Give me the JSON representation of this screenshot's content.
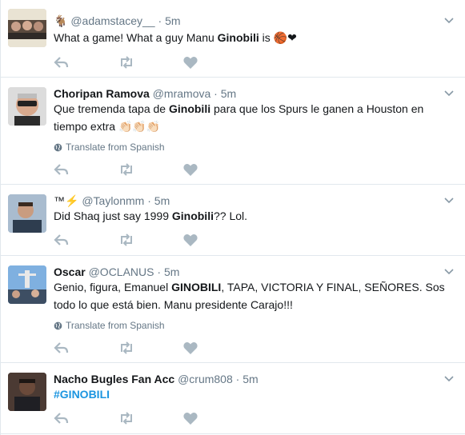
{
  "tweets": [
    {
      "fullname": "",
      "emoji_prefix": "🐐",
      "username": "@adamstacey__",
      "time": "5m",
      "text_before": "What a game! What a guy Manu ",
      "bold": "Ginobili",
      "text_after": " is ",
      "emoji_suffix": "🏀❤",
      "translate": ""
    },
    {
      "fullname": "Choripan Ramova",
      "username": "@mramova",
      "time": "5m",
      "text_before": "Que tremenda tapa de ",
      "bold": "Ginobili",
      "text_after": " para que los Spurs le ganen a Houston en tiempo extra ",
      "emoji_suffix": "👏🏻👏🏻👏🏻",
      "translate": "Translate from Spanish"
    },
    {
      "fullname": "",
      "emoji_prefix": "™⚡",
      "username": "@Taylonmm",
      "time": "5m",
      "text_before": "Did Shaq just say 1999 ",
      "bold": "Ginobili",
      "text_after": "?? Lol.",
      "translate": ""
    },
    {
      "fullname": "Oscar",
      "username": "@OCLANUS",
      "time": "5m",
      "text_before": "Genio, figura, Emanuel ",
      "bold": "GINOBILI",
      "text_after": ", TAPA, VICTORIA Y FINAL, SEÑORES. Sos todo lo que está bien. Manu presidente Carajo!!!",
      "translate": "Translate from Spanish"
    },
    {
      "fullname": "Nacho Bugles Fan Acc",
      "username": "@crum808",
      "time": "5m",
      "hashtag": "#GINOBILI",
      "translate": ""
    }
  ],
  "separator": "·",
  "colors": {
    "meta": "#657786",
    "icon": "#aab8c2",
    "link": "#1b95e0",
    "border": "#e1e8ed"
  }
}
